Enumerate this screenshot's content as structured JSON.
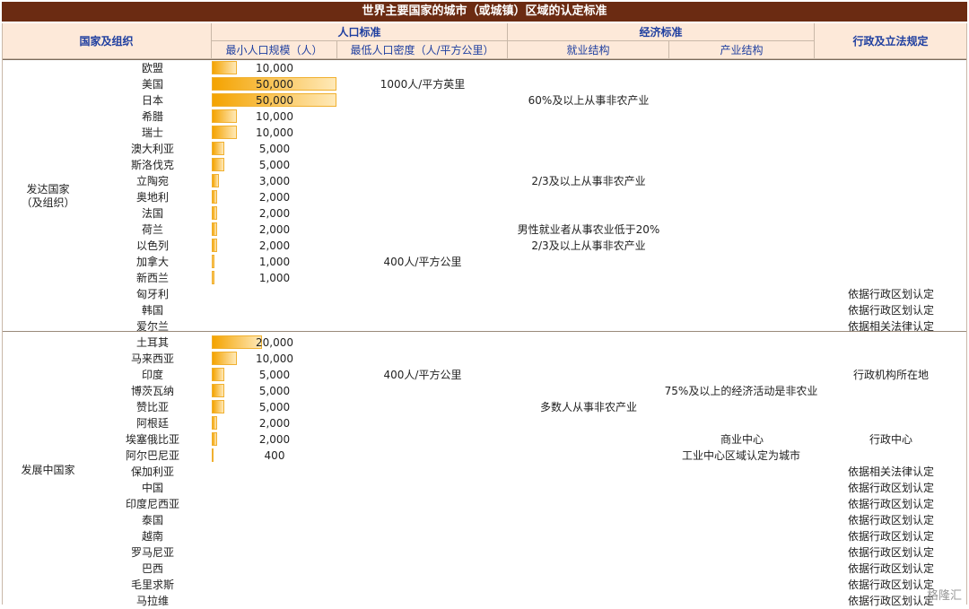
{
  "title": "世界主要国家的城市（或城镇）区域的认定标准",
  "headers": {
    "country": "国家及组织",
    "population": "人口标准",
    "min_pop": "最小人口规模（人）",
    "min_density": "最低人口密度（人/平方公里）",
    "economic": "经济标准",
    "employment": "就业结构",
    "industry": "产业结构",
    "admin": "行政及立法规定"
  },
  "groups": {
    "developed": "发达国家\n（及组织）",
    "developing": "发展中国家"
  },
  "chart_data": {
    "type": "table",
    "columns": [
      "国家及组织",
      "最小人口规模（人）",
      "最低人口密度（人/平方公里）",
      "就业结构",
      "产业结构",
      "行政及立法规定"
    ],
    "bar_max": 50000,
    "rows": [
      {
        "country": "欧盟",
        "pop": 10000,
        "pop_label": "10,000",
        "density": "",
        "employment": "",
        "industry": "",
        "admin": ""
      },
      {
        "country": "美国",
        "pop": 50000,
        "pop_label": "50,000",
        "density": "1000人/平方英里",
        "employment": "",
        "industry": "",
        "admin": ""
      },
      {
        "country": "日本",
        "pop": 50000,
        "pop_label": "50,000",
        "density": "",
        "employment": "60%及以上从事非农产业",
        "industry": "",
        "admin": ""
      },
      {
        "country": "希腊",
        "pop": 10000,
        "pop_label": "10,000",
        "density": "",
        "employment": "",
        "industry": "",
        "admin": ""
      },
      {
        "country": "瑞士",
        "pop": 10000,
        "pop_label": "10,000",
        "density": "",
        "employment": "",
        "industry": "",
        "admin": ""
      },
      {
        "country": "澳大利亚",
        "pop": 5000,
        "pop_label": "5,000",
        "density": "",
        "employment": "",
        "industry": "",
        "admin": ""
      },
      {
        "country": "斯洛伐克",
        "pop": 5000,
        "pop_label": "5,000",
        "density": "",
        "employment": "",
        "industry": "",
        "admin": ""
      },
      {
        "country": "立陶宛",
        "pop": 3000,
        "pop_label": "3,000",
        "density": "",
        "employment": "2/3及以上从事非农产业",
        "industry": "",
        "admin": ""
      },
      {
        "country": "奥地利",
        "pop": 2000,
        "pop_label": "2,000",
        "density": "",
        "employment": "",
        "industry": "",
        "admin": ""
      },
      {
        "country": "法国",
        "pop": 2000,
        "pop_label": "2,000",
        "density": "",
        "employment": "",
        "industry": "",
        "admin": ""
      },
      {
        "country": "荷兰",
        "pop": 2000,
        "pop_label": "2,000",
        "density": "",
        "employment": "男性就业者从事农业低于20%",
        "industry": "",
        "admin": ""
      },
      {
        "country": "以色列",
        "pop": 2000,
        "pop_label": "2,000",
        "density": "",
        "employment": "2/3及以上从事非农产业",
        "industry": "",
        "admin": ""
      },
      {
        "country": "加拿大",
        "pop": 1000,
        "pop_label": "1,000",
        "density": "400人/平方公里",
        "employment": "",
        "industry": "",
        "admin": ""
      },
      {
        "country": "新西兰",
        "pop": 1000,
        "pop_label": "1,000",
        "density": "",
        "employment": "",
        "industry": "",
        "admin": ""
      },
      {
        "country": "匈牙利",
        "pop": null,
        "pop_label": "",
        "density": "",
        "employment": "",
        "industry": "",
        "admin": "依据行政区划认定"
      },
      {
        "country": "韩国",
        "pop": null,
        "pop_label": "",
        "density": "",
        "employment": "",
        "industry": "",
        "admin": "依据行政区划认定"
      },
      {
        "country": "爱尔兰",
        "pop": null,
        "pop_label": "",
        "density": "",
        "employment": "",
        "industry": "",
        "admin": "依据相关法律认定"
      },
      {
        "country": "土耳其",
        "pop": 20000,
        "pop_label": "20,000",
        "density": "",
        "employment": "",
        "industry": "",
        "admin": ""
      },
      {
        "country": "马来西亚",
        "pop": 10000,
        "pop_label": "10,000",
        "density": "",
        "employment": "",
        "industry": "",
        "admin": ""
      },
      {
        "country": "印度",
        "pop": 5000,
        "pop_label": "5,000",
        "density": "400人/平方公里",
        "employment": "",
        "industry": "",
        "admin": "行政机构所在地"
      },
      {
        "country": "博茨瓦纳",
        "pop": 5000,
        "pop_label": "5,000",
        "density": "",
        "employment": "",
        "industry": "75%及以上的经济活动是非农业",
        "admin": ""
      },
      {
        "country": "赞比亚",
        "pop": 5000,
        "pop_label": "5,000",
        "density": "",
        "employment": "多数人从事非农产业",
        "industry": "",
        "admin": ""
      },
      {
        "country": "阿根廷",
        "pop": 2000,
        "pop_label": "2,000",
        "density": "",
        "employment": "",
        "industry": "",
        "admin": ""
      },
      {
        "country": "埃塞俄比亚",
        "pop": 2000,
        "pop_label": "2,000",
        "density": "",
        "employment": "",
        "industry": "商业中心",
        "admin": "行政中心"
      },
      {
        "country": "阿尔巴尼亚",
        "pop": 400,
        "pop_label": "400",
        "density": "",
        "employment": "",
        "industry": "工业中心区域认定为城市",
        "admin": ""
      },
      {
        "country": "保加利亚",
        "pop": null,
        "pop_label": "",
        "density": "",
        "employment": "",
        "industry": "",
        "admin": "依据相关法律认定"
      },
      {
        "country": "中国",
        "pop": null,
        "pop_label": "",
        "density": "",
        "employment": "",
        "industry": "",
        "admin": "依据行政区划认定"
      },
      {
        "country": "印度尼西亚",
        "pop": null,
        "pop_label": "",
        "density": "",
        "employment": "",
        "industry": "",
        "admin": "依据行政区划认定"
      },
      {
        "country": "泰国",
        "pop": null,
        "pop_label": "",
        "density": "",
        "employment": "",
        "industry": "",
        "admin": "依据行政区划认定"
      },
      {
        "country": "越南",
        "pop": null,
        "pop_label": "",
        "density": "",
        "employment": "",
        "industry": "",
        "admin": "依据行政区划认定"
      },
      {
        "country": "罗马尼亚",
        "pop": null,
        "pop_label": "",
        "density": "",
        "employment": "",
        "industry": "",
        "admin": "依据行政区划认定"
      },
      {
        "country": "巴西",
        "pop": null,
        "pop_label": "",
        "density": "",
        "employment": "",
        "industry": "",
        "admin": "依据行政区划认定"
      },
      {
        "country": "毛里求斯",
        "pop": null,
        "pop_label": "",
        "density": "",
        "employment": "",
        "industry": "",
        "admin": "依据行政区划认定"
      },
      {
        "country": "马拉维",
        "pop": null,
        "pop_label": "",
        "density": "",
        "employment": "",
        "industry": "",
        "admin": "依据行政区划认定"
      }
    ]
  },
  "watermark": "格隆汇",
  "colors": {
    "title_bg": "#6b2b12",
    "header_bg": "#fde9d9",
    "header_text": "#1f3fa0",
    "bar": "#f4a300"
  }
}
